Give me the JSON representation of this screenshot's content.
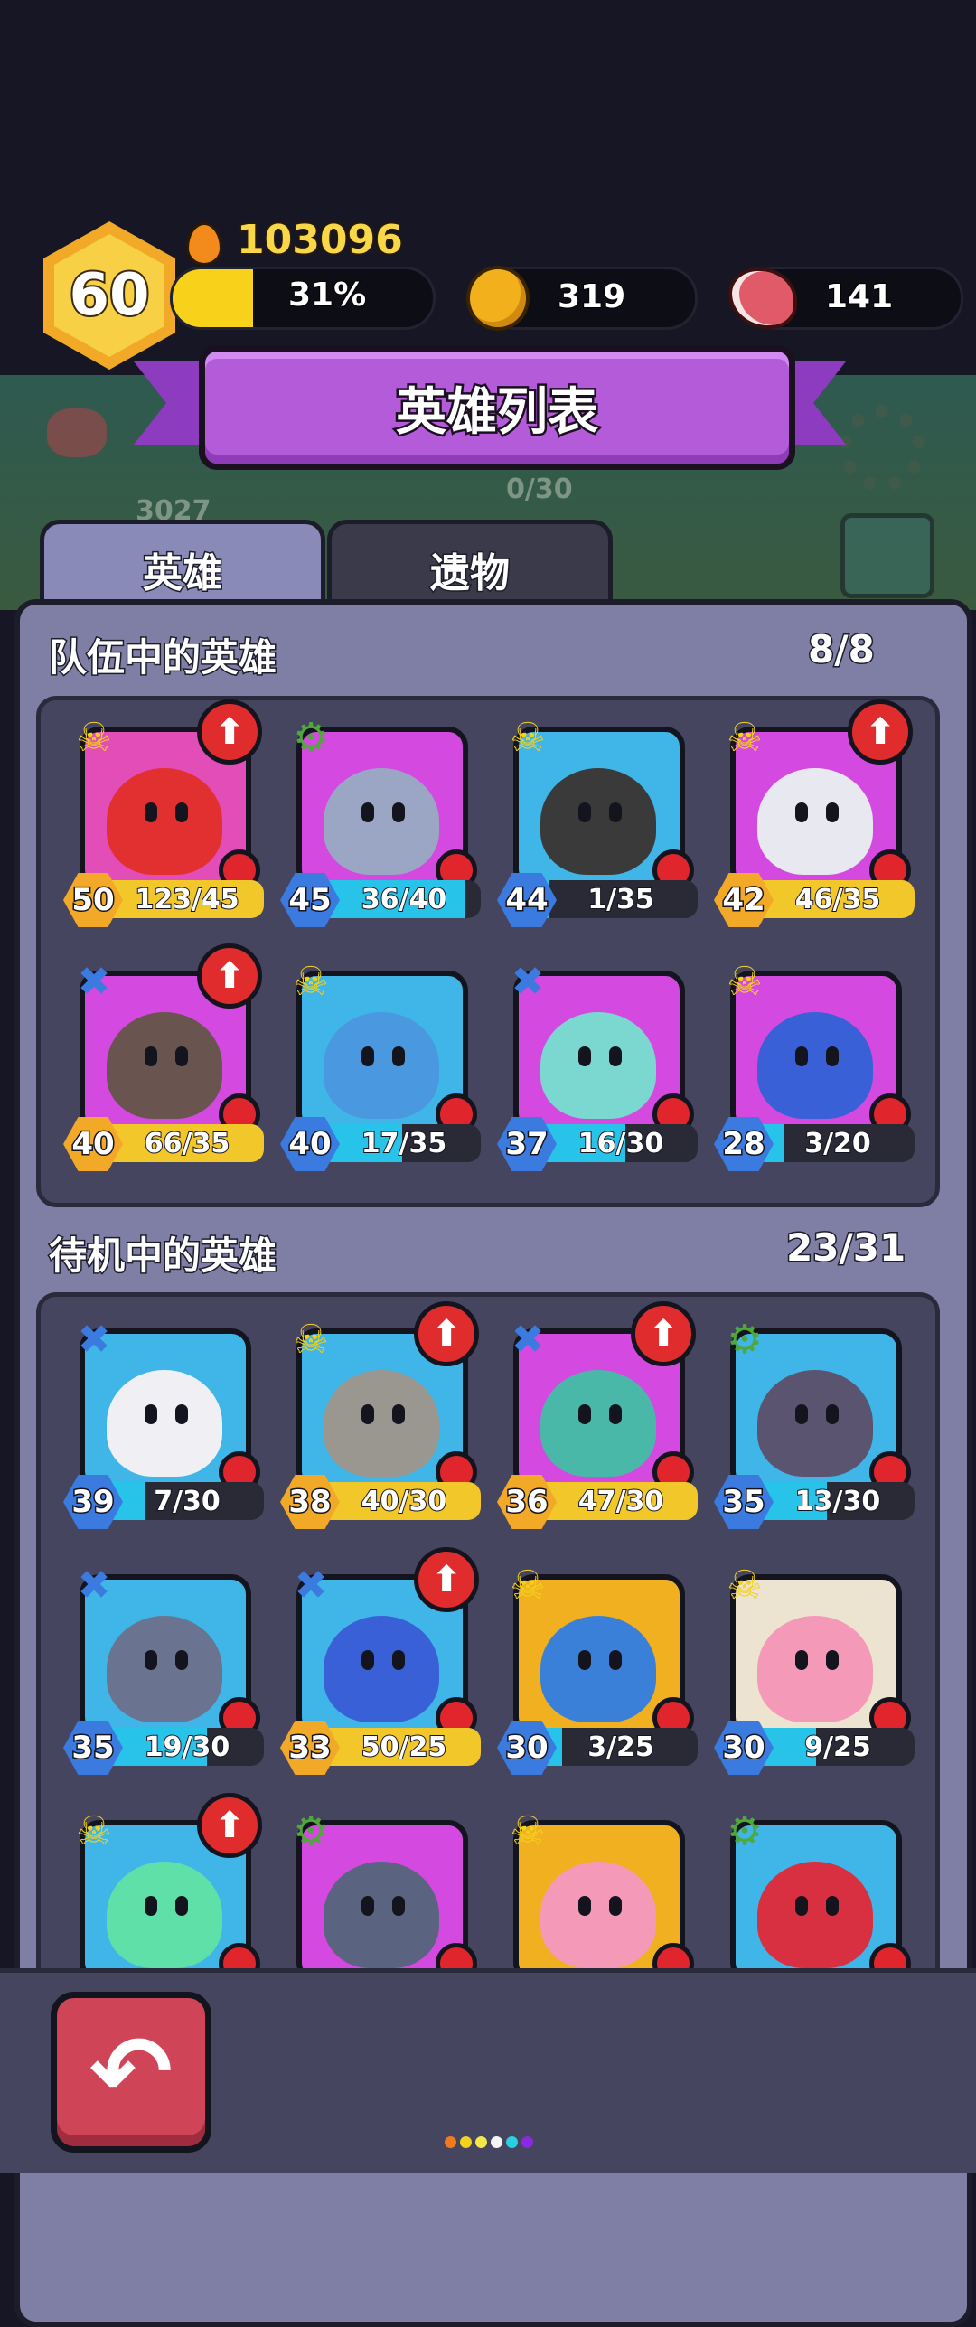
{
  "hud": {
    "level": "60",
    "power": "103096",
    "xp_percent_label": "31%",
    "xp_fraction": 0.31,
    "gold": "319",
    "meat": "141"
  },
  "banner": {
    "title": "英雄列表"
  },
  "background_hints": {
    "left_value": "3027",
    "center_value": "0/30"
  },
  "tabs": [
    {
      "label": "英雄",
      "active": true
    },
    {
      "label": "遗物",
      "active": false
    }
  ],
  "team": {
    "title": "队伍中的英雄",
    "count": "8/8",
    "heroes": [
      {
        "level": "50",
        "progress": "123/45",
        "fill": 1.0,
        "bar": "gold",
        "role": "skull",
        "role_color": "#f2d21c",
        "upgrade": true,
        "bg": "#e24db7",
        "face": "#e23030"
      },
      {
        "level": "45",
        "progress": "36/40",
        "fill": 0.9,
        "bar": "cyan",
        "role": "gear",
        "role_color": "#4ea83a",
        "upgrade": false,
        "bg": "#d44ae0",
        "face": "#9aa6c4"
      },
      {
        "level": "44",
        "progress": "1/35",
        "fill": 0.03,
        "bar": "cyan",
        "role": "skull",
        "role_color": "#f2d21c",
        "upgrade": false,
        "bg": "#3fb5e8",
        "face": "#3a3a3a"
      },
      {
        "level": "42",
        "progress": "46/35",
        "fill": 1.0,
        "bar": "gold",
        "role": "skull",
        "role_color": "#f2d21c",
        "upgrade": true,
        "bg": "#d44ae0",
        "face": "#e8e8f0"
      },
      {
        "level": "40",
        "progress": "66/35",
        "fill": 1.0,
        "bar": "gold",
        "role": "cross",
        "role_color": "#3b7be0",
        "upgrade": true,
        "bg": "#d44ae0",
        "face": "#6a5450"
      },
      {
        "level": "40",
        "progress": "17/35",
        "fill": 0.49,
        "bar": "cyan",
        "role": "skull",
        "role_color": "#f2d21c",
        "upgrade": false,
        "bg": "#3fb5e8",
        "face": "#4a98e0"
      },
      {
        "level": "37",
        "progress": "16/30",
        "fill": 0.53,
        "bar": "cyan",
        "role": "cross",
        "role_color": "#3b7be0",
        "upgrade": false,
        "bg": "#d44ae0",
        "face": "#7ad8d0"
      },
      {
        "level": "28",
        "progress": "3/20",
        "fill": 0.15,
        "bar": "cyan",
        "role": "skull",
        "role_color": "#f2d21c",
        "upgrade": false,
        "bg": "#d44ae0",
        "face": "#3a60d8"
      }
    ]
  },
  "standby": {
    "title": "待机中的英雄",
    "count": "23/31",
    "heroes": [
      {
        "level": "39",
        "progress": "7/30",
        "fill": 0.23,
        "bar": "cyan",
        "role": "cross",
        "role_color": "#3b7be0",
        "upgrade": false,
        "bg": "#3fb5e8",
        "face": "#f0f0f4"
      },
      {
        "level": "38",
        "progress": "40/30",
        "fill": 1.0,
        "bar": "gold",
        "role": "skull",
        "role_color": "#f2d21c",
        "upgrade": true,
        "bg": "#3fb5e8",
        "face": "#9a9690"
      },
      {
        "level": "36",
        "progress": "47/30",
        "fill": 1.0,
        "bar": "gold",
        "role": "cross",
        "role_color": "#3b7be0",
        "upgrade": true,
        "bg": "#d44ae0",
        "face": "#4ab8a8"
      },
      {
        "level": "35",
        "progress": "13/30",
        "fill": 0.43,
        "bar": "cyan",
        "role": "gear",
        "role_color": "#4ea83a",
        "upgrade": false,
        "bg": "#3fb5e8",
        "face": "#5a5470"
      },
      {
        "level": "35",
        "progress": "19/30",
        "fill": 0.63,
        "bar": "cyan",
        "role": "cross",
        "role_color": "#3b7be0",
        "upgrade": false,
        "bg": "#3fb5e8",
        "face": "#6a7490"
      },
      {
        "level": "33",
        "progress": "50/25",
        "fill": 1.0,
        "bar": "gold",
        "role": "cross",
        "role_color": "#3b7be0",
        "upgrade": true,
        "bg": "#3fb5e8",
        "face": "#3a60d8"
      },
      {
        "level": "30",
        "progress": "3/25",
        "fill": 0.12,
        "bar": "cyan",
        "role": "skull",
        "role_color": "#f2d21c",
        "upgrade": false,
        "bg": "#f0b020",
        "face": "#3a80d8"
      },
      {
        "level": "30",
        "progress": "9/25",
        "fill": 0.36,
        "bar": "cyan",
        "role": "skull",
        "role_color": "#f2d21c",
        "upgrade": false,
        "bg": "#ece4d0",
        "face": "#f49ab8"
      },
      {
        "level": "",
        "progress": "",
        "fill": 0,
        "bar": "cyan",
        "role": "skull",
        "role_color": "#f2d21c",
        "upgrade": true,
        "bg": "#3fb5e8",
        "face": "#5ee0a8"
      },
      {
        "level": "",
        "progress": "",
        "fill": 0,
        "bar": "cyan",
        "role": "gear",
        "role_color": "#4ea83a",
        "upgrade": false,
        "bg": "#d44ae0",
        "face": "#5a6480"
      },
      {
        "level": "",
        "progress": "",
        "fill": 0,
        "bar": "cyan",
        "role": "skull",
        "role_color": "#f2d21c",
        "upgrade": false,
        "bg": "#f0b020",
        "face": "#f49ab8"
      },
      {
        "level": "",
        "progress": "",
        "fill": 0,
        "bar": "cyan",
        "role": "gear",
        "role_color": "#4ea83a",
        "upgrade": false,
        "bg": "#3fb5e8",
        "face": "#d83040"
      }
    ]
  },
  "bottom": {
    "back_icon": "back-arrow-icon"
  },
  "page_dots": [
    "#f27a1c",
    "#f2d21c",
    "#f2e84a",
    "#f4f4f4",
    "#2ad0e0",
    "#8a2ae0"
  ],
  "colors": {
    "gold_bar": "#f2c72a",
    "cyan_bar": "#27c3e8",
    "gold_hex": "#f2a928",
    "blue_hex": "#3b7be0"
  }
}
